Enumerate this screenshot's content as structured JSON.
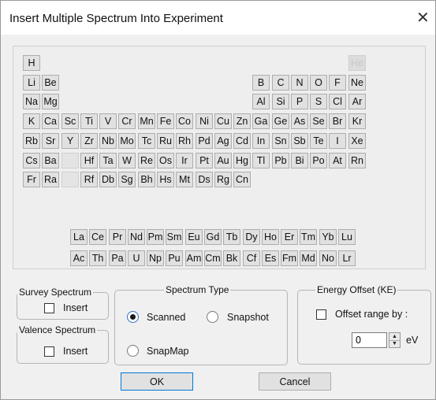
{
  "window": {
    "title": "Insert Multiple Spectrum Into Experiment",
    "close": "✕"
  },
  "periodic_table": {
    "main": [
      [
        {
          "s": "H"
        },
        null,
        null,
        null,
        null,
        null,
        null,
        null,
        null,
        null,
        null,
        null,
        null,
        null,
        null,
        null,
        null,
        {
          "s": "He",
          "disabled": true
        }
      ],
      [
        {
          "s": "Li"
        },
        {
          "s": "Be"
        },
        null,
        null,
        null,
        null,
        null,
        null,
        null,
        null,
        null,
        null,
        {
          "s": "B"
        },
        {
          "s": "C"
        },
        {
          "s": "N"
        },
        {
          "s": "O"
        },
        {
          "s": "F"
        },
        {
          "s": "Ne"
        }
      ],
      [
        {
          "s": "Na"
        },
        {
          "s": "Mg"
        },
        null,
        null,
        null,
        null,
        null,
        null,
        null,
        null,
        null,
        null,
        {
          "s": "Al"
        },
        {
          "s": "Si"
        },
        {
          "s": "P"
        },
        {
          "s": "S"
        },
        {
          "s": "Cl"
        },
        {
          "s": "Ar"
        }
      ],
      [
        {
          "s": "K"
        },
        {
          "s": "Ca"
        },
        {
          "s": "Sc"
        },
        {
          "s": "Ti"
        },
        {
          "s": "V"
        },
        {
          "s": "Cr"
        },
        {
          "s": "Mn"
        },
        {
          "s": "Fe"
        },
        {
          "s": "Co"
        },
        {
          "s": "Ni"
        },
        {
          "s": "Cu"
        },
        {
          "s": "Zn"
        },
        {
          "s": "Ga"
        },
        {
          "s": "Ge"
        },
        {
          "s": "As"
        },
        {
          "s": "Se"
        },
        {
          "s": "Br"
        },
        {
          "s": "Kr"
        }
      ],
      [
        {
          "s": "Rb"
        },
        {
          "s": "Sr"
        },
        {
          "s": "Y"
        },
        {
          "s": "Zr"
        },
        {
          "s": "Nb"
        },
        {
          "s": "Mo"
        },
        {
          "s": "Tc"
        },
        {
          "s": "Ru"
        },
        {
          "s": "Rh"
        },
        {
          "s": "Pd"
        },
        {
          "s": "Ag"
        },
        {
          "s": "Cd"
        },
        {
          "s": "In"
        },
        {
          "s": "Sn"
        },
        {
          "s": "Sb"
        },
        {
          "s": "Te"
        },
        {
          "s": "I"
        },
        {
          "s": "Xe"
        }
      ],
      [
        {
          "s": "Cs"
        },
        {
          "s": "Ba"
        },
        {
          "s": "",
          "blank": true
        },
        {
          "s": "Hf"
        },
        {
          "s": "Ta"
        },
        {
          "s": "W"
        },
        {
          "s": "Re"
        },
        {
          "s": "Os"
        },
        {
          "s": "Ir"
        },
        {
          "s": "Pt"
        },
        {
          "s": "Au"
        },
        {
          "s": "Hg"
        },
        {
          "s": "Tl"
        },
        {
          "s": "Pb"
        },
        {
          "s": "Bi"
        },
        {
          "s": "Po"
        },
        {
          "s": "At"
        },
        {
          "s": "Rn"
        }
      ],
      [
        {
          "s": "Fr"
        },
        {
          "s": "Ra"
        },
        {
          "s": "",
          "blank": true
        },
        {
          "s": "Rf"
        },
        {
          "s": "Db"
        },
        {
          "s": "Sg"
        },
        {
          "s": "Bh"
        },
        {
          "s": "Hs"
        },
        {
          "s": "Mt"
        },
        {
          "s": "Ds"
        },
        {
          "s": "Rg"
        },
        {
          "s": "Cn"
        },
        null,
        null,
        null,
        null,
        null,
        null
      ]
    ],
    "lanthanides": [
      "La",
      "Ce",
      "Pr",
      "Nd",
      "Pm",
      "Sm",
      "Eu",
      "Gd",
      "Tb",
      "Dy",
      "Ho",
      "Er",
      "Tm",
      "Yb",
      "Lu"
    ],
    "actinides": [
      "Ac",
      "Th",
      "Pa",
      "U",
      "Np",
      "Pu",
      "Am",
      "Cm",
      "Bk",
      "Cf",
      "Es",
      "Fm",
      "Md",
      "No",
      "Lr"
    ]
  },
  "survey": {
    "legend": "Survey Spectrum",
    "label": "Insert",
    "checked": false
  },
  "valence": {
    "legend": "Valence Spectrum",
    "label": "Insert",
    "checked": false
  },
  "spectrum_type": {
    "legend": "Spectrum Type",
    "options": [
      {
        "label": "Scanned",
        "selected": true
      },
      {
        "label": "Snapshot",
        "selected": false
      },
      {
        "label": "SnapMap",
        "selected": false
      }
    ]
  },
  "energy_offset": {
    "legend": "Energy Offset (KE)",
    "label": "Offset range by :",
    "checked": false,
    "value": "0",
    "unit": "eV"
  },
  "buttons": {
    "ok": "OK",
    "cancel": "Cancel"
  }
}
